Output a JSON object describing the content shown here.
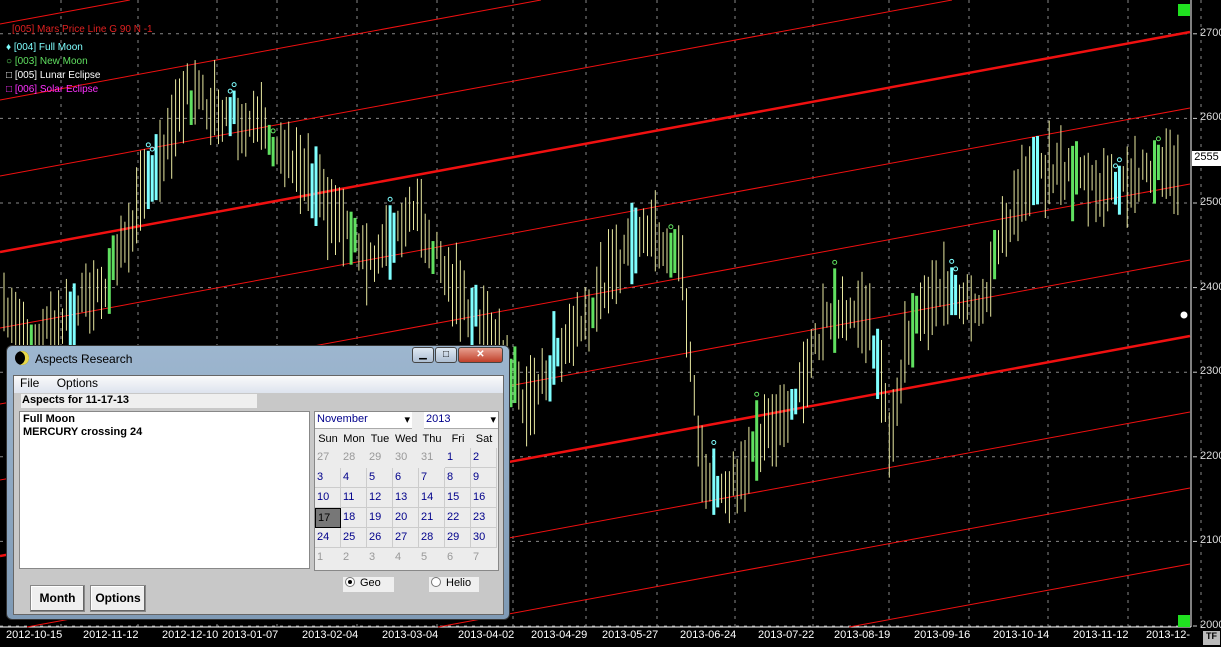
{
  "legend": [
    {
      "label": "[005] Mars Price Line G 90 N -1",
      "color": "#e02020"
    },
    {
      "label": "[004] Full Moon",
      "color": "#7fffff"
    },
    {
      "label": "[003] New Moon",
      "color": "#60e060"
    },
    {
      "label": "[005] Lunar Eclipse",
      "color": "#ffffff"
    },
    {
      "label": "[006] Solar Eclipse",
      "color": "#ff30ff"
    }
  ],
  "chart_data": {
    "type": "line",
    "title": "Price chart with Mars price lines and lunar events",
    "x_tick_labels": [
      "2012-10-15",
      "2012-11-12",
      "2012-12-10",
      "2013-01-07",
      "2013-02-04",
      "2013-03-04",
      "2013-04-02",
      "2013-04-29",
      "2013-05-27",
      "2013-06-24",
      "2013-07-22",
      "2013-08-19",
      "2013-09-16",
      "2013-10-14",
      "2013-11-12",
      "2013-12-"
    ],
    "y_tick_labels": [
      "2000",
      "2100",
      "2200",
      "2300",
      "2400",
      "2500",
      "2600",
      "2700"
    ],
    "ylim": [
      2000,
      2700
    ],
    "last_price": "2555",
    "price_path": [
      {
        "date": "2012-10-01",
        "close": 2400
      },
      {
        "date": "2012-10-15",
        "close": 2330
      },
      {
        "date": "2012-11-12",
        "close": 2410
      },
      {
        "date": "2012-12-10",
        "close": 2630
      },
      {
        "date": "2013-01-07",
        "close": 2590
      },
      {
        "date": "2013-02-04",
        "close": 2480
      },
      {
        "date": "2013-02-18",
        "close": 2430
      },
      {
        "date": "2013-03-04",
        "close": 2500
      },
      {
        "date": "2013-03-18",
        "close": 2400
      },
      {
        "date": "2013-04-02",
        "close": 2340
      },
      {
        "date": "2013-04-15",
        "close": 2260
      },
      {
        "date": "2013-04-29",
        "close": 2340
      },
      {
        "date": "2013-05-13",
        "close": 2400
      },
      {
        "date": "2013-05-27",
        "close": 2480
      },
      {
        "date": "2013-06-10",
        "close": 2440
      },
      {
        "date": "2013-06-17",
        "close": 2200
      },
      {
        "date": "2013-06-24",
        "close": 2150
      },
      {
        "date": "2013-07-22",
        "close": 2270
      },
      {
        "date": "2013-08-05",
        "close": 2380
      },
      {
        "date": "2013-08-19",
        "close": 2360
      },
      {
        "date": "2013-08-26",
        "close": 2220
      },
      {
        "date": "2013-09-02",
        "close": 2350
      },
      {
        "date": "2013-09-16",
        "close": 2400
      },
      {
        "date": "2013-09-30",
        "close": 2380
      },
      {
        "date": "2013-10-07",
        "close": 2470
      },
      {
        "date": "2013-10-14",
        "close": 2520
      },
      {
        "date": "2013-10-28",
        "close": 2540
      },
      {
        "date": "2013-11-12",
        "close": 2520
      },
      {
        "date": "2013-12-09",
        "close": 2540
      }
    ]
  },
  "axis": {
    "tf_label": "TF"
  },
  "dialog": {
    "title": "Aspects Research",
    "menu": [
      "File",
      "Options"
    ],
    "aspects_header": "Aspects for 11-17-13",
    "aspects": [
      "Full Moon",
      "MERCURY crossing 24"
    ],
    "month": "November",
    "year": "2013",
    "weekdays": [
      "Sun",
      "Mon",
      "Tue",
      "Wed",
      "Thu",
      "Fri",
      "Sat"
    ],
    "days": [
      "27",
      "28",
      "29",
      "30",
      "31",
      "1",
      "2",
      "3",
      "4",
      "5",
      "6",
      "7",
      "8",
      "9",
      "10",
      "11",
      "12",
      "13",
      "14",
      "15",
      "16",
      "17",
      "18",
      "19",
      "20",
      "21",
      "22",
      "23",
      "24",
      "25",
      "26",
      "27",
      "28",
      "29",
      "30",
      "1",
      "2",
      "3",
      "4",
      "5",
      "6",
      "7"
    ],
    "selected_day": "17",
    "radio": [
      {
        "label": "Geo",
        "checked": true
      },
      {
        "label": "Helio",
        "checked": false
      }
    ],
    "buttons": [
      "Month",
      "Options"
    ]
  }
}
